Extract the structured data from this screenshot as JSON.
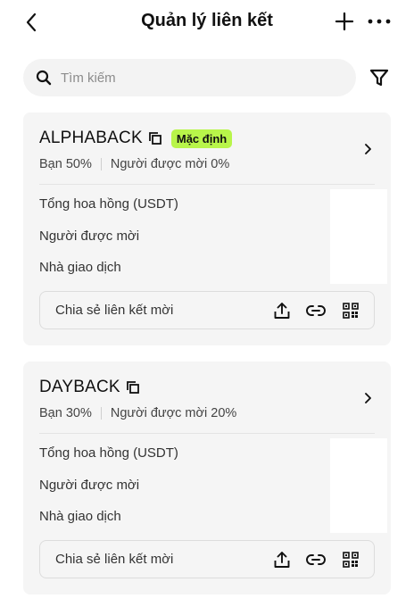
{
  "header": {
    "title": "Quản lý liên kết",
    "back_icon": "chevron-left-icon",
    "add_icon": "plus-icon",
    "more_icon": "more-horizontal-icon"
  },
  "search": {
    "placeholder": "Tìm kiếm",
    "value": ""
  },
  "colors": {
    "badge_bg": "#b8f54a",
    "card_bg": "#f5f5f5",
    "search_bg": "#f3f3f3"
  },
  "links": [
    {
      "code": "ALPHABACK",
      "badge": "Mặc định",
      "you_rate": "Bạn 50%",
      "invitee_rate": "Người được mời 0%",
      "stats": {
        "total_commission_label": "Tổng hoa hồng (USDT)",
        "invitees_label": "Người được mời",
        "traders_label": "Nhà giao dịch"
      },
      "share_label": "Chia sẻ liên kết mời"
    },
    {
      "code": "DAYBACK",
      "you_rate": "Bạn 30%",
      "invitee_rate": "Người được mời 20%",
      "stats": {
        "total_commission_label": "Tổng hoa hồng (USDT)",
        "invitees_label": "Người được mời",
        "traders_label": "Nhà giao dịch"
      },
      "share_label": "Chia sẻ liên kết mời"
    }
  ]
}
